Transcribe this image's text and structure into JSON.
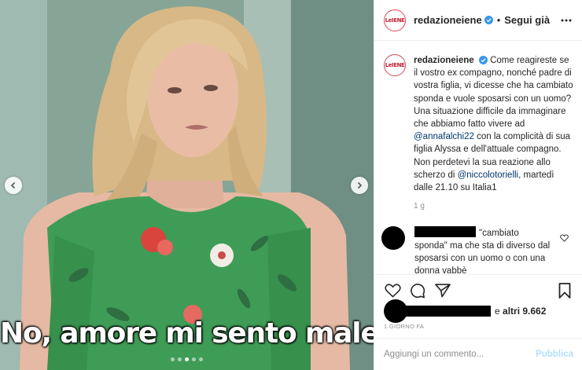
{
  "media": {
    "caption_overlay": "No, amore mi sento male",
    "carousel": {
      "count": 5,
      "active_index": 2
    }
  },
  "header": {
    "avatar_logo": "LeIENE",
    "username": "redazioneiene",
    "separator": "•",
    "follow_label": "Segui già"
  },
  "post": {
    "author": "redazioneiene",
    "caption_parts": [
      {
        "text": "Come reagireste se il vostro ex compagno, nonché padre di vostra figlia, vi dicesse che ha cambiato sponda e vuole sposarsi con un uomo? Una situazione difficile da immaginare che abbiamo fatto vivere ad "
      },
      {
        "mention": "@annafalchi22"
      },
      {
        "text": " con la complicità di sua figlia Alyssa e dell'attuale compagno. Non perdetevi la sua reazione allo scherzo di "
      },
      {
        "mention": "@niccolotorielli"
      },
      {
        "text": ", martedì dalle 21.10 su Italia1"
      }
    ],
    "time_ago": "1 g"
  },
  "comment": {
    "text": "\"cambiato sponda\" ma che sta di diverso dal sposarsi con un uomo o con una donna vabbè"
  },
  "likes": {
    "prefix": "e",
    "label": "altri 9.662"
  },
  "date": "1 GIORNO FA",
  "add_comment": {
    "placeholder": "Aggiungi un commento...",
    "publish_label": "Pubblica"
  },
  "colors": {
    "mention": "#00376b",
    "publish_disabled": "#b2dffc",
    "verified": "#3897f0",
    "muted": "#8e8e8e"
  }
}
